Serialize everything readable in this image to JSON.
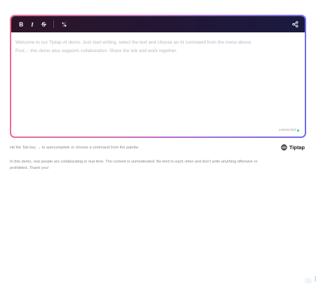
{
  "toolbar": {
    "buttons": [
      {
        "name": "bold",
        "glyph": "B"
      },
      {
        "name": "italic",
        "glyph": "I"
      },
      {
        "name": "strikethrough",
        "glyph": "S"
      }
    ],
    "ai_icon": "ai-sparkle-icon",
    "share_icon": "share-icon"
  },
  "editor": {
    "paragraphs": [
      "Welcome to our Tiptap AI demo. Just start writing, select the text and choose an AI command from the menu above.",
      "Psst… this demo also supports collaboration. Share the link and work together."
    ],
    "status_text": "connected",
    "status_color": "#3ccf7a"
  },
  "hint": "Hit the Tab key → to autocomplete or choose a command from the palette.",
  "brand": {
    "name": "Tiptap"
  },
  "note": "In this demo, real people are collaborating in real time. The content is unmoderated. Be kind to each other and don't write anything offensive or prohibited. Thank you!",
  "colors": {
    "border_start": "#ec6b8e",
    "border_end": "#6f6cf0",
    "toolbar_bg": "#231634"
  }
}
